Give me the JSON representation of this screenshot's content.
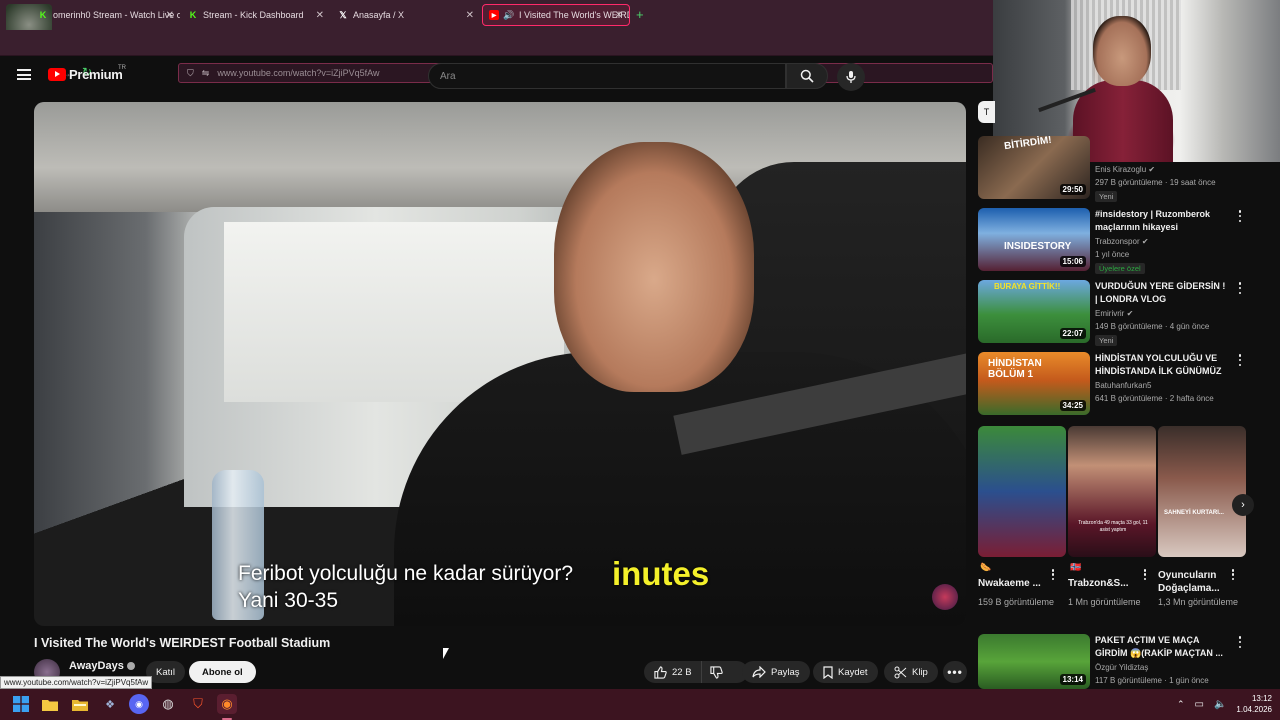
{
  "browser": {
    "tabs": [
      {
        "label": "omerinh0 Stream - Watch Live o",
        "icon": "kick-icon",
        "active": false
      },
      {
        "label": "Stream - Kick Dashboard",
        "icon": "kick-icon",
        "active": false
      },
      {
        "label": "Anasayfa / X",
        "icon": "x-icon",
        "active": false
      },
      {
        "label": "I Visited The World's WEIRDE",
        "icon": "youtube-icon",
        "active": true
      }
    ],
    "url": "www.youtube.com/watch?v=iZjiPVq5fAw"
  },
  "youtube": {
    "logo_text": "Premium",
    "region": "TR",
    "search_placeholder": "Ara"
  },
  "video": {
    "subtitle_line1": "Feribot yolculuğu ne kadar sürüyor?",
    "subtitle_line2": "Yani 30-35",
    "burned_caption": "inutes",
    "title": "I Visited The World's WEIRDEST Football Stadium",
    "channel": "AwayDays",
    "join_label": "Katıl",
    "subscribe_label": "Abone ol",
    "likes": "22 B",
    "share_label": "Paylaş",
    "save_label": "Kaydet",
    "clip_label": "Klip"
  },
  "status_url": "www.youtube.com/watch?v=iZjiPVq5fAw",
  "sidebar": {
    "chip": "T",
    "recommendations": [
      {
        "title": "",
        "channel": "Enis Kirazoglu",
        "verified": true,
        "meta": "297 B görüntüleme · 19 saat önce",
        "badge": "Yeni",
        "duration": "29:50",
        "thumb_text": "BİTİRDİM!"
      },
      {
        "title": "#insidestory | Ruzomberok maçlarının hikayesi",
        "channel": "Trabzonspor",
        "verified": true,
        "meta": "1 yıl önce",
        "badge": "Üyelere özel",
        "duration": "15:06",
        "thumb_text": "INSIDESTORY"
      },
      {
        "title": "VURDUĞUN YERE GİDERSİN ! | LONDRA VLOG",
        "channel": "Emirivrir",
        "verified": true,
        "meta": "149 B görüntüleme · 4 gün önce",
        "badge": "Yeni",
        "duration": "22:07",
        "thumb_text": "BURAYA GİTTİK!!"
      },
      {
        "title": "HİNDİSTAN YOLCULUĞU VE HİNDİSTANDA İLK GÜNÜMÜZ ...",
        "channel": "Batuhanfurkan5",
        "verified": false,
        "meta": "641 B görüntüleme · 2 hafta önce",
        "badge": "",
        "duration": "34:25",
        "thumb_text": "HİNDİSTAN BÖLÜM 1"
      },
      {
        "title": "PAKET AÇTIM VE MAÇA GİRDİM 😱(RAKİP MAÇTAN ...",
        "channel": "Özgür Yildiztaş",
        "verified": false,
        "meta": "117 B görüntüleme · 1 gün önce",
        "badge": "",
        "duration": "13:14",
        "thumb_text": ""
      }
    ],
    "shorts": [
      {
        "title": "Nwakaeme ...",
        "views": "159 B görüntüleme",
        "thumb_text": "",
        "tag": "🌭"
      },
      {
        "title": "Trabzon&S...",
        "views": "1 Mn görüntüleme",
        "thumb_text": "Trabzon'da 49 maçta 33 gol, 11 asist yaptım",
        "tag": "🇳🇴"
      },
      {
        "title": "Oyuncuların Doğaçlama...",
        "views": "1,3 Mn görüntüleme",
        "thumb_text": "SAHNEYİ KURTARI...",
        "tag": ""
      }
    ]
  },
  "taskbar": {
    "time": "13:12",
    "date": "1.04.2026"
  },
  "colors": {
    "browser_bg": "#3a1f2e",
    "active_tab_border": "#ff2a6a",
    "youtube_red": "#ff0000",
    "members_green": "#2ba640"
  }
}
